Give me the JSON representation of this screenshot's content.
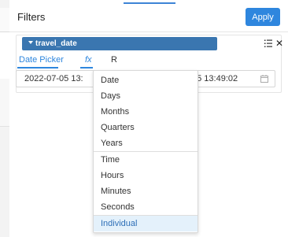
{
  "panel": {
    "title": "Filters",
    "apply_label": "Apply"
  },
  "filter": {
    "field_name": "travel_date"
  },
  "tabs": {
    "date_picker": "Date Picker",
    "fx": "fx",
    "r": "R"
  },
  "input": {
    "left_value": "2022-07-05 13:",
    "right_value": "05 13:49:02"
  },
  "dropdown": {
    "options": [
      "Date",
      "Days",
      "Months",
      "Quarters",
      "Years",
      "Time",
      "Hours",
      "Minutes",
      "Seconds",
      "Individual"
    ],
    "selected": "Individual"
  },
  "colors": {
    "accent": "#2e86de",
    "field_bar": "#3a76b0",
    "selected_bg": "#e4f1fb"
  }
}
